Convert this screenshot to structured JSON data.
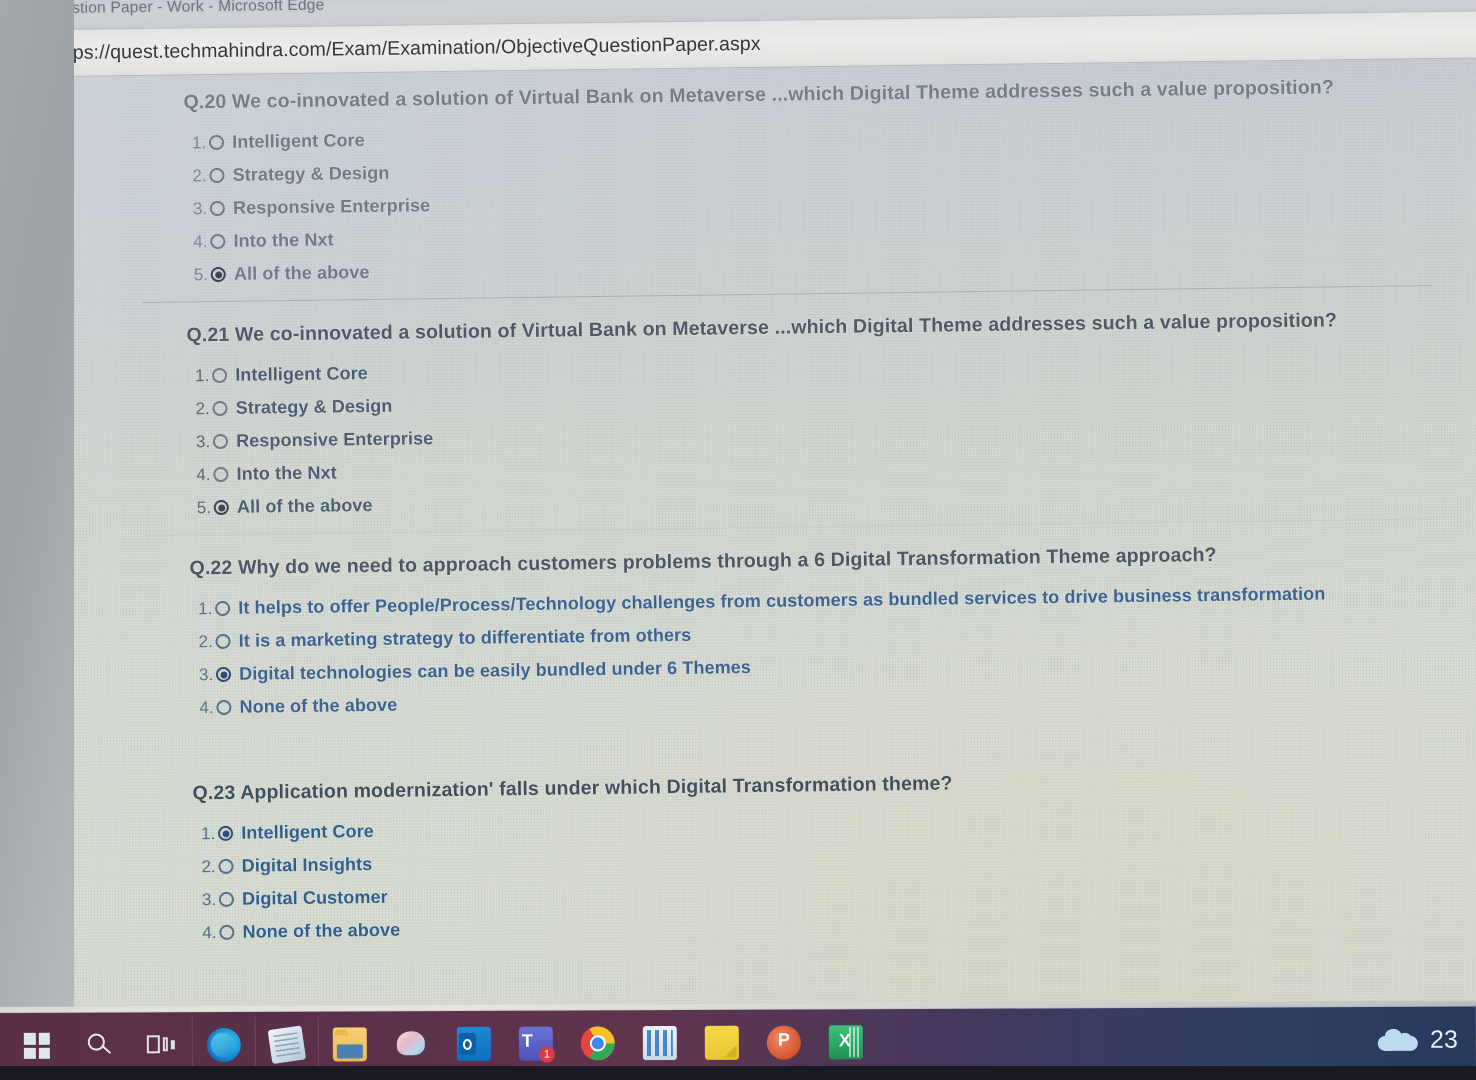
{
  "window": {
    "title": "Question Paper - Work - Microsoft Edge",
    "favicon": "document-icon"
  },
  "addressbar": {
    "lock_icon": "lock-icon",
    "url": "https://quest.techmahindra.com/Exam/Examination/ObjectiveQuestionPaper.aspx"
  },
  "questions": [
    {
      "id": "q20",
      "text": "Q.20 We co-innovated a solution of Virtual Bank on Metaverse ...which Digital Theme addresses such a value proposition?",
      "options": [
        {
          "num": "1.",
          "label": "Intelligent Core",
          "selected": false
        },
        {
          "num": "2.",
          "label": "Strategy & Design",
          "selected": false
        },
        {
          "num": "3.",
          "label": "Responsive Enterprise",
          "selected": false
        },
        {
          "num": "4.",
          "label": "Into the Nxt",
          "selected": false
        },
        {
          "num": "5.",
          "label": "All of the above",
          "selected": true
        }
      ]
    },
    {
      "id": "q21",
      "text": "Q.21 We co-innovated a solution of Virtual Bank on Metaverse ...which Digital Theme addresses such a value proposition?",
      "options": [
        {
          "num": "1.",
          "label": "Intelligent Core",
          "selected": false
        },
        {
          "num": "2.",
          "label": "Strategy & Design",
          "selected": false
        },
        {
          "num": "3.",
          "label": "Responsive Enterprise",
          "selected": false
        },
        {
          "num": "4.",
          "label": "Into the Nxt",
          "selected": false
        },
        {
          "num": "5.",
          "label": "All of the above",
          "selected": true
        }
      ]
    },
    {
      "id": "q22",
      "text": "Q.22 Why do we need to approach customers problems through a 6 Digital Transformation Theme approach?",
      "options": [
        {
          "num": "1.",
          "label": "It helps to offer People/Process/Technology challenges from customers as bundled services to drive business transformation",
          "selected": false
        },
        {
          "num": "2.",
          "label": "It is a marketing strategy to differentiate from others",
          "selected": false
        },
        {
          "num": "3.",
          "label": "Digital technologies can be easily bundled under 6 Themes",
          "selected": true
        },
        {
          "num": "4.",
          "label": "None of the above",
          "selected": false
        }
      ]
    },
    {
      "id": "q23",
      "text": "Q.23 Application modernization' falls under which Digital Transformation theme?",
      "options": [
        {
          "num": "1.",
          "label": "Intelligent Core",
          "selected": true
        },
        {
          "num": "2.",
          "label": "Digital Insights",
          "selected": false
        },
        {
          "num": "3.",
          "label": "Digital Customer",
          "selected": false
        },
        {
          "num": "4.",
          "label": "None of the above",
          "selected": false
        }
      ]
    }
  ],
  "taskbar": {
    "start": "windows-start-icon",
    "search": "search-icon",
    "taskview": "task-view-icon",
    "apps": [
      {
        "name": "microsoft-edge",
        "glyph": "edge-icon"
      },
      {
        "name": "notepad",
        "glyph": "notepad-icon"
      },
      {
        "name": "file-explorer",
        "glyph": "folder-icon"
      },
      {
        "name": "paint",
        "glyph": "paint-icon"
      },
      {
        "name": "outlook",
        "glyph": "outlook-icon"
      },
      {
        "name": "microsoft-teams",
        "glyph": "teams-icon",
        "badge": "1"
      },
      {
        "name": "google-chrome",
        "glyph": "chrome-icon"
      },
      {
        "name": "calculator",
        "glyph": "calculator-icon"
      },
      {
        "name": "sticky-notes",
        "glyph": "notes-icon"
      },
      {
        "name": "powerpoint",
        "glyph": "powerpoint-icon"
      },
      {
        "name": "excel",
        "glyph": "excel-icon"
      }
    ],
    "weather": {
      "icon": "cloud-icon",
      "temperature": "23"
    }
  },
  "colors": {
    "taskbar_left": "#5c2f48",
    "taskbar_right": "#26395c",
    "page_bg": "#d5d9d2",
    "option_link": "#2f5f8e"
  }
}
